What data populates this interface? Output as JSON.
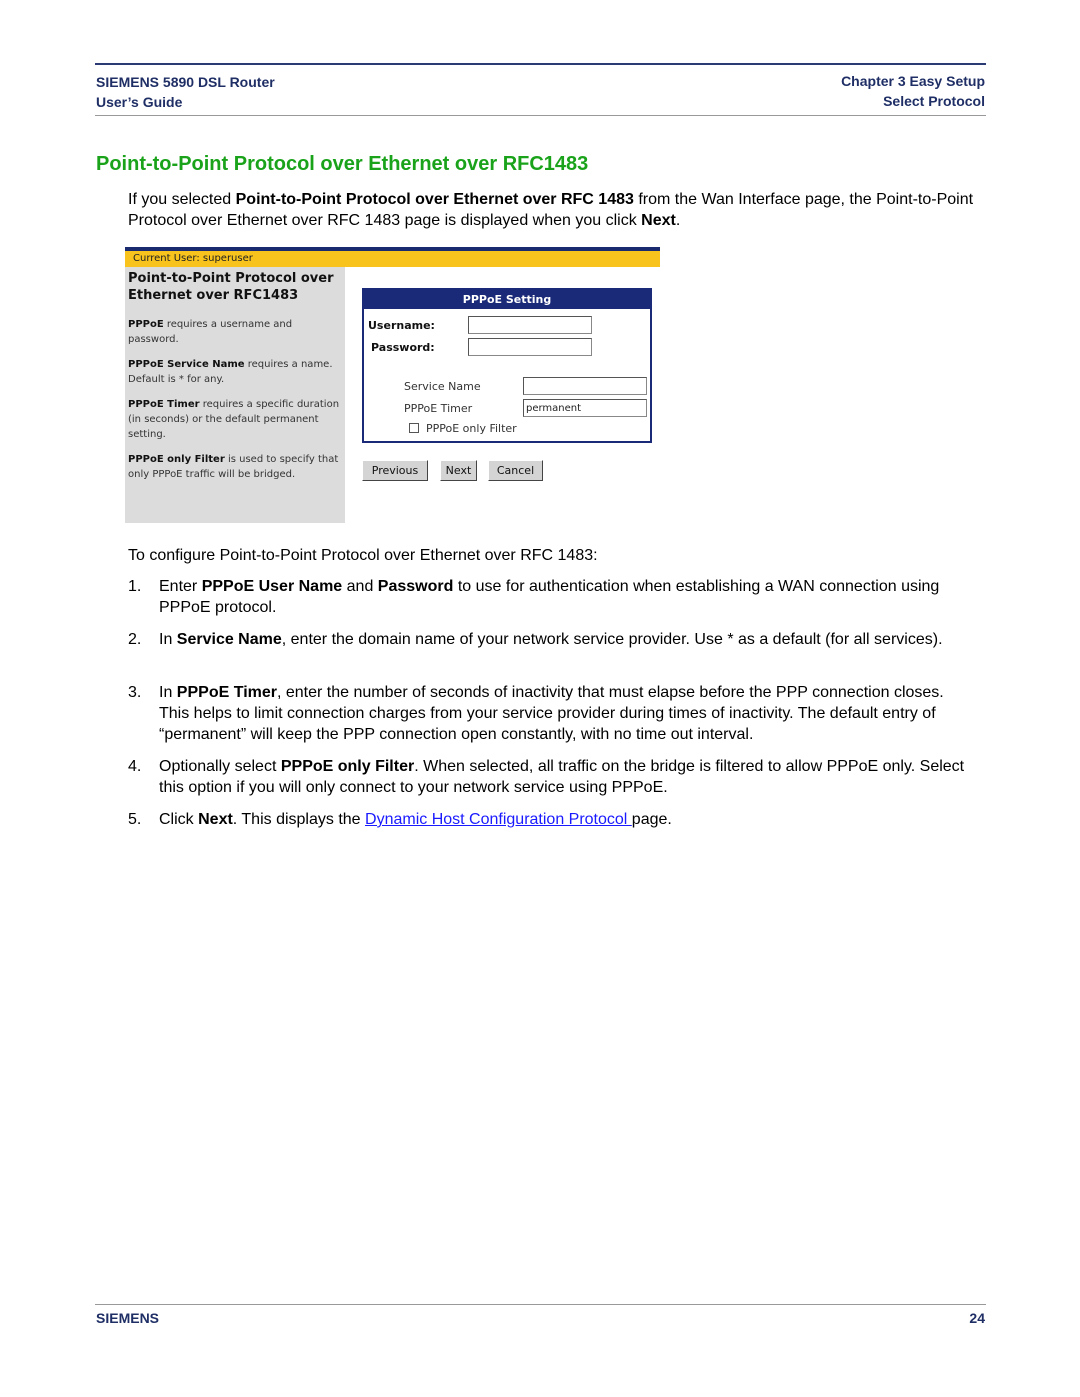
{
  "header": {
    "left_line1": "SIEMENS 5890 DSL Router",
    "left_line2": "User’s Guide",
    "right_line1": "Chapter 3  Easy Setup",
    "right_line2": "Select Protocol"
  },
  "section_title": "Point-to-Point Protocol over Ethernet over RFC1483",
  "intro": {
    "p1": "If you selected ",
    "p1_bold": "Point-to-Point Protocol over Ethernet over RFC 1483",
    "p2": " from the Wan Interface page, the Point-to-Point Protocol over Ethernet over RFC 1483 page is displayed when you click ",
    "p2_bold": "Next",
    "p3": "."
  },
  "screenshot": {
    "current_user": "Current User: superuser",
    "side_title": "Point-to-Point Protocol over Ethernet over RFC1483",
    "help": [
      {
        "bold": "PPPoE",
        "text": " requires a username and password."
      },
      {
        "bold": "PPPoE Service Name",
        "text": " requires a name. Default is * for any."
      },
      {
        "bold": "PPPoE Timer",
        "text": " requires a specific duration (in seconds) or the default permanent setting."
      },
      {
        "bold": "PPPoE only Filter",
        "text": " is used to specify that only PPPoE traffic will be bridged."
      }
    ],
    "panel_title": "PPPoE Setting",
    "username_label": "Username:",
    "username_value": "",
    "password_label": "Password:",
    "password_value": "",
    "service_name_label": "Service Name",
    "service_name_value": "",
    "timer_label": "PPPoE Timer",
    "timer_value": "permanent",
    "filter_label": "PPPoE only Filter",
    "filter_checked": false,
    "buttons": {
      "previous": "Previous",
      "next": "Next",
      "cancel": "Cancel"
    }
  },
  "configure_intro": "To configure Point-to-Point Protocol over Ethernet over RFC 1483:",
  "steps": [
    {
      "num": "1.",
      "parts": [
        {
          "t": "Enter "
        },
        {
          "b": "PPPoE User Name"
        },
        {
          "t": " and "
        },
        {
          "b": "Password"
        },
        {
          "t": " to use for authentication when establishing a WAN connection using PPPoE protocol."
        }
      ]
    },
    {
      "num": "2.",
      "parts": [
        {
          "t": "In "
        },
        {
          "b": "Service Name"
        },
        {
          "t": ", enter the domain name of your network service provider. Use * as a default (for all services)."
        }
      ]
    },
    {
      "num": "3.",
      "parts": [
        {
          "t": "In "
        },
        {
          "b": "PPPoE Timer"
        },
        {
          "t": ", enter the number of seconds of inactivity that must elapse before the PPP connection closes. This helps to limit connection charges from your service provider during times of inactivity. The default entry of “permanent” will keep the PPP connection open constantly, with no time out interval."
        }
      ]
    },
    {
      "num": "4.",
      "parts": [
        {
          "t": "Optionally select "
        },
        {
          "b": "PPPoE only Filter"
        },
        {
          "t": ". When selected, all traffic on the bridge is filtered to allow PPPoE only. Select this option if you will only connect to your network service using PPPoE."
        }
      ]
    },
    {
      "num": "5.",
      "parts": [
        {
          "t": "Click "
        },
        {
          "b": "Next"
        },
        {
          "t": ". This displays the "
        },
        {
          "link": "Dynamic Host Configuration Protocol "
        },
        {
          "t": "page."
        }
      ]
    }
  ],
  "footer": {
    "brand": "SIEMENS",
    "page_number": "24"
  },
  "colors": {
    "title_green": "#1aa31a",
    "header_navy": "#1f2f66",
    "panel_navy": "#1a2a78",
    "user_bar": "#f7c31c",
    "link": "#1a1aff"
  }
}
